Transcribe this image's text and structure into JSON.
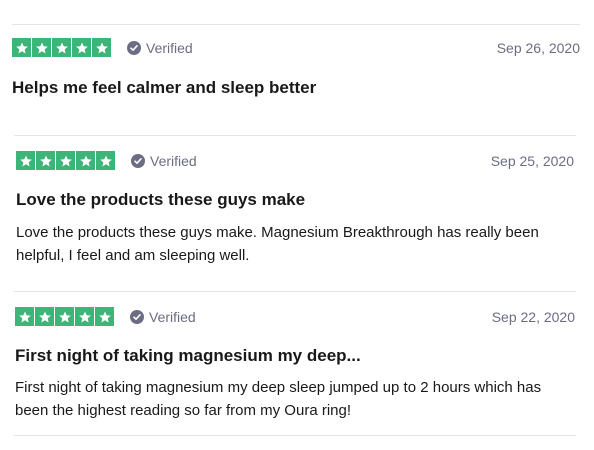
{
  "reviews": [
    {
      "rating": 5,
      "verified_label": "Verified",
      "date": "Sep 26, 2020",
      "title": "Helps me feel calmer and sleep better",
      "body": ""
    },
    {
      "rating": 5,
      "verified_label": "Verified",
      "date": "Sep 25, 2020",
      "title": "Love the products these guys make",
      "body": "Love the products these guys make. Magnesium Breakthrough has really been helpful, I feel and am sleeping well."
    },
    {
      "rating": 5,
      "verified_label": "Verified",
      "date": "Sep 22, 2020",
      "title": "First night of taking magnesium my deep...",
      "body": "First night of taking magnesium my deep sleep jumped up to 2 hours which has been the highest reading so far from my Oura ring!"
    }
  ],
  "colors": {
    "star_background": "#3cb578",
    "verified_gray": "#6c6c85",
    "divider": "#e5e5e8"
  },
  "icons": {
    "star": "star-icon",
    "verified": "verified-check-icon"
  }
}
